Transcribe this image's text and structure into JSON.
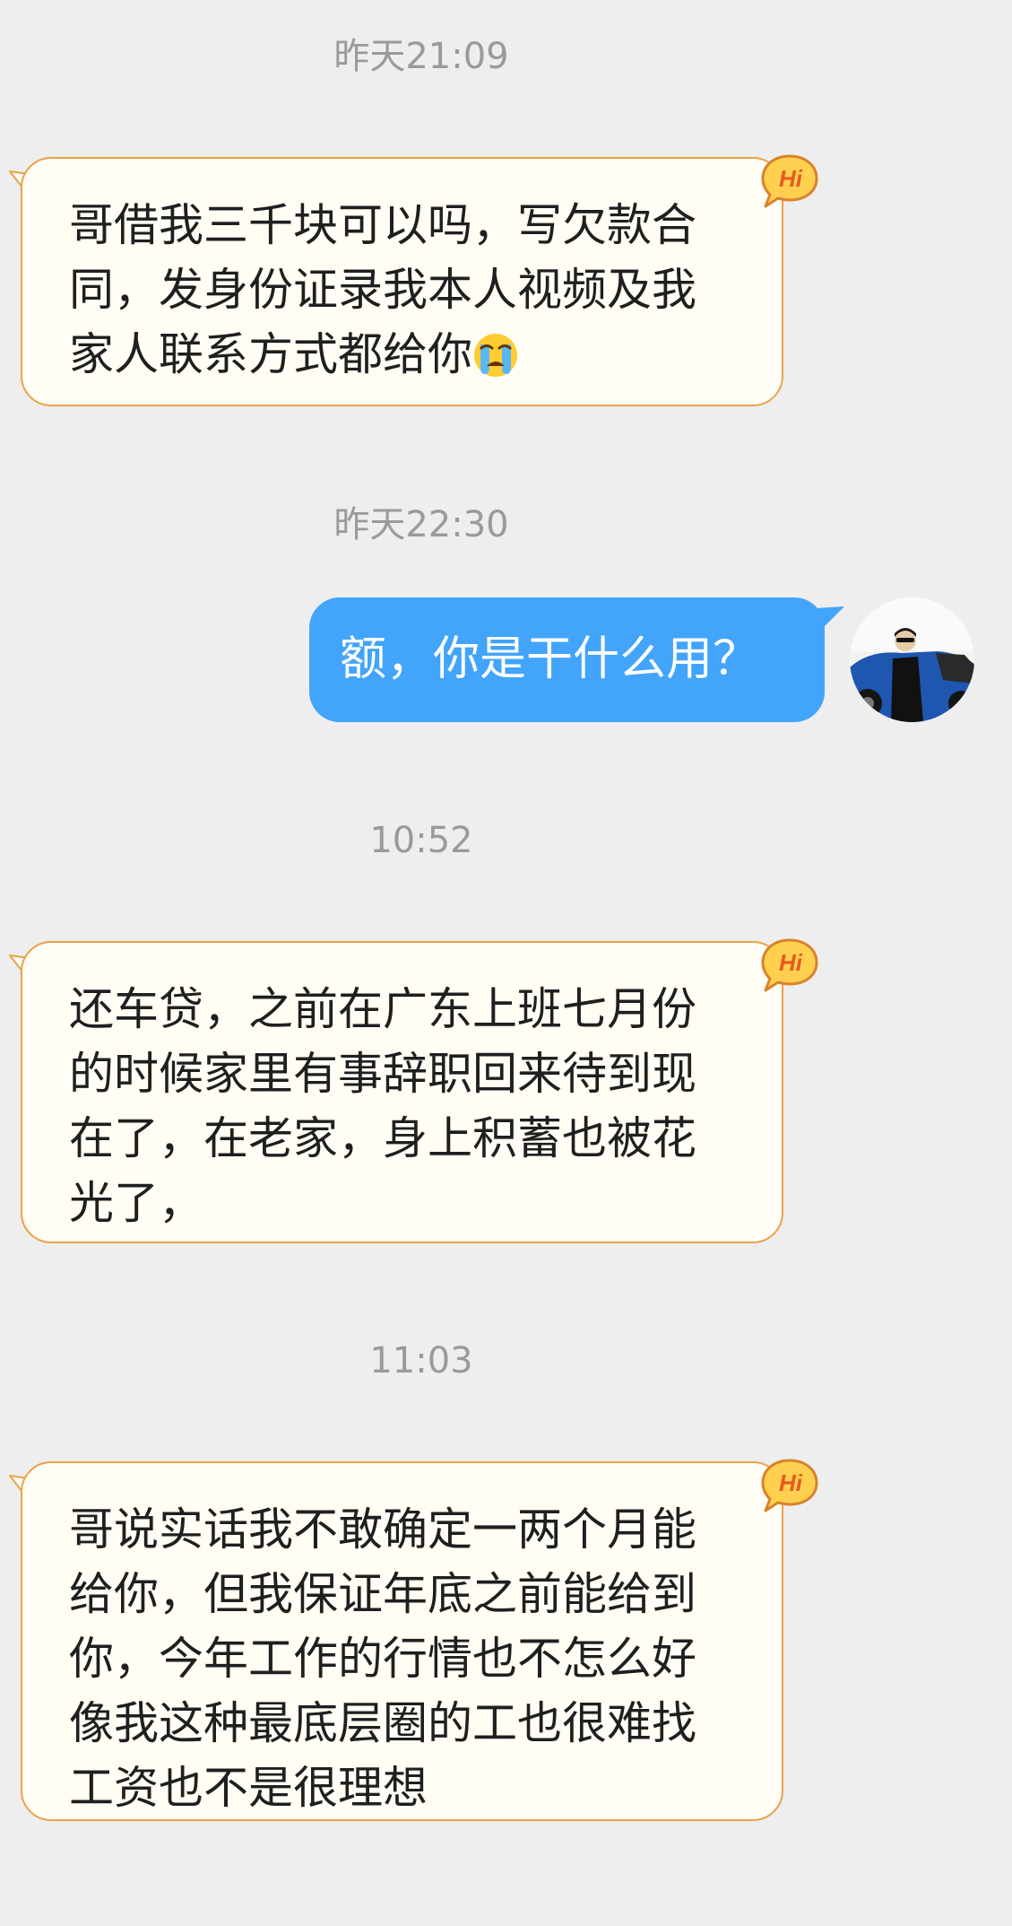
{
  "timestamps": [
    "昨天21:09",
    "昨天22:30",
    "10:52",
    "11:03"
  ],
  "messages": [
    {
      "side": "received",
      "text": "哥借我三千块可以吗，写欠款合同，发身份证录我本人视频及我家人联系方式都给你",
      "emoji": "loudly-crying-face",
      "badge": "Hi"
    },
    {
      "side": "sent",
      "text": "额，你是干什么用？"
    },
    {
      "side": "received",
      "text": "还车贷，之前在广东上班七月份的时候家里有事辞职回来待到现在了，在老家，身上积蓄也被花光了，",
      "badge": "Hi"
    },
    {
      "side": "received",
      "text": "哥说实话我不敢确定一两个月能给你，但我保证年底之前能给到你，今年工作的行情也不怎么好像我这种最底层圈的工也很难找工资也不是很理想",
      "badge": "Hi"
    }
  ],
  "colors": {
    "background": "#eeeeee",
    "received_bubble": "#fffdf4",
    "received_border": "#e9a24a",
    "sent_bubble": "#42a4fb",
    "timestamp_text": "#9a9a9a"
  }
}
